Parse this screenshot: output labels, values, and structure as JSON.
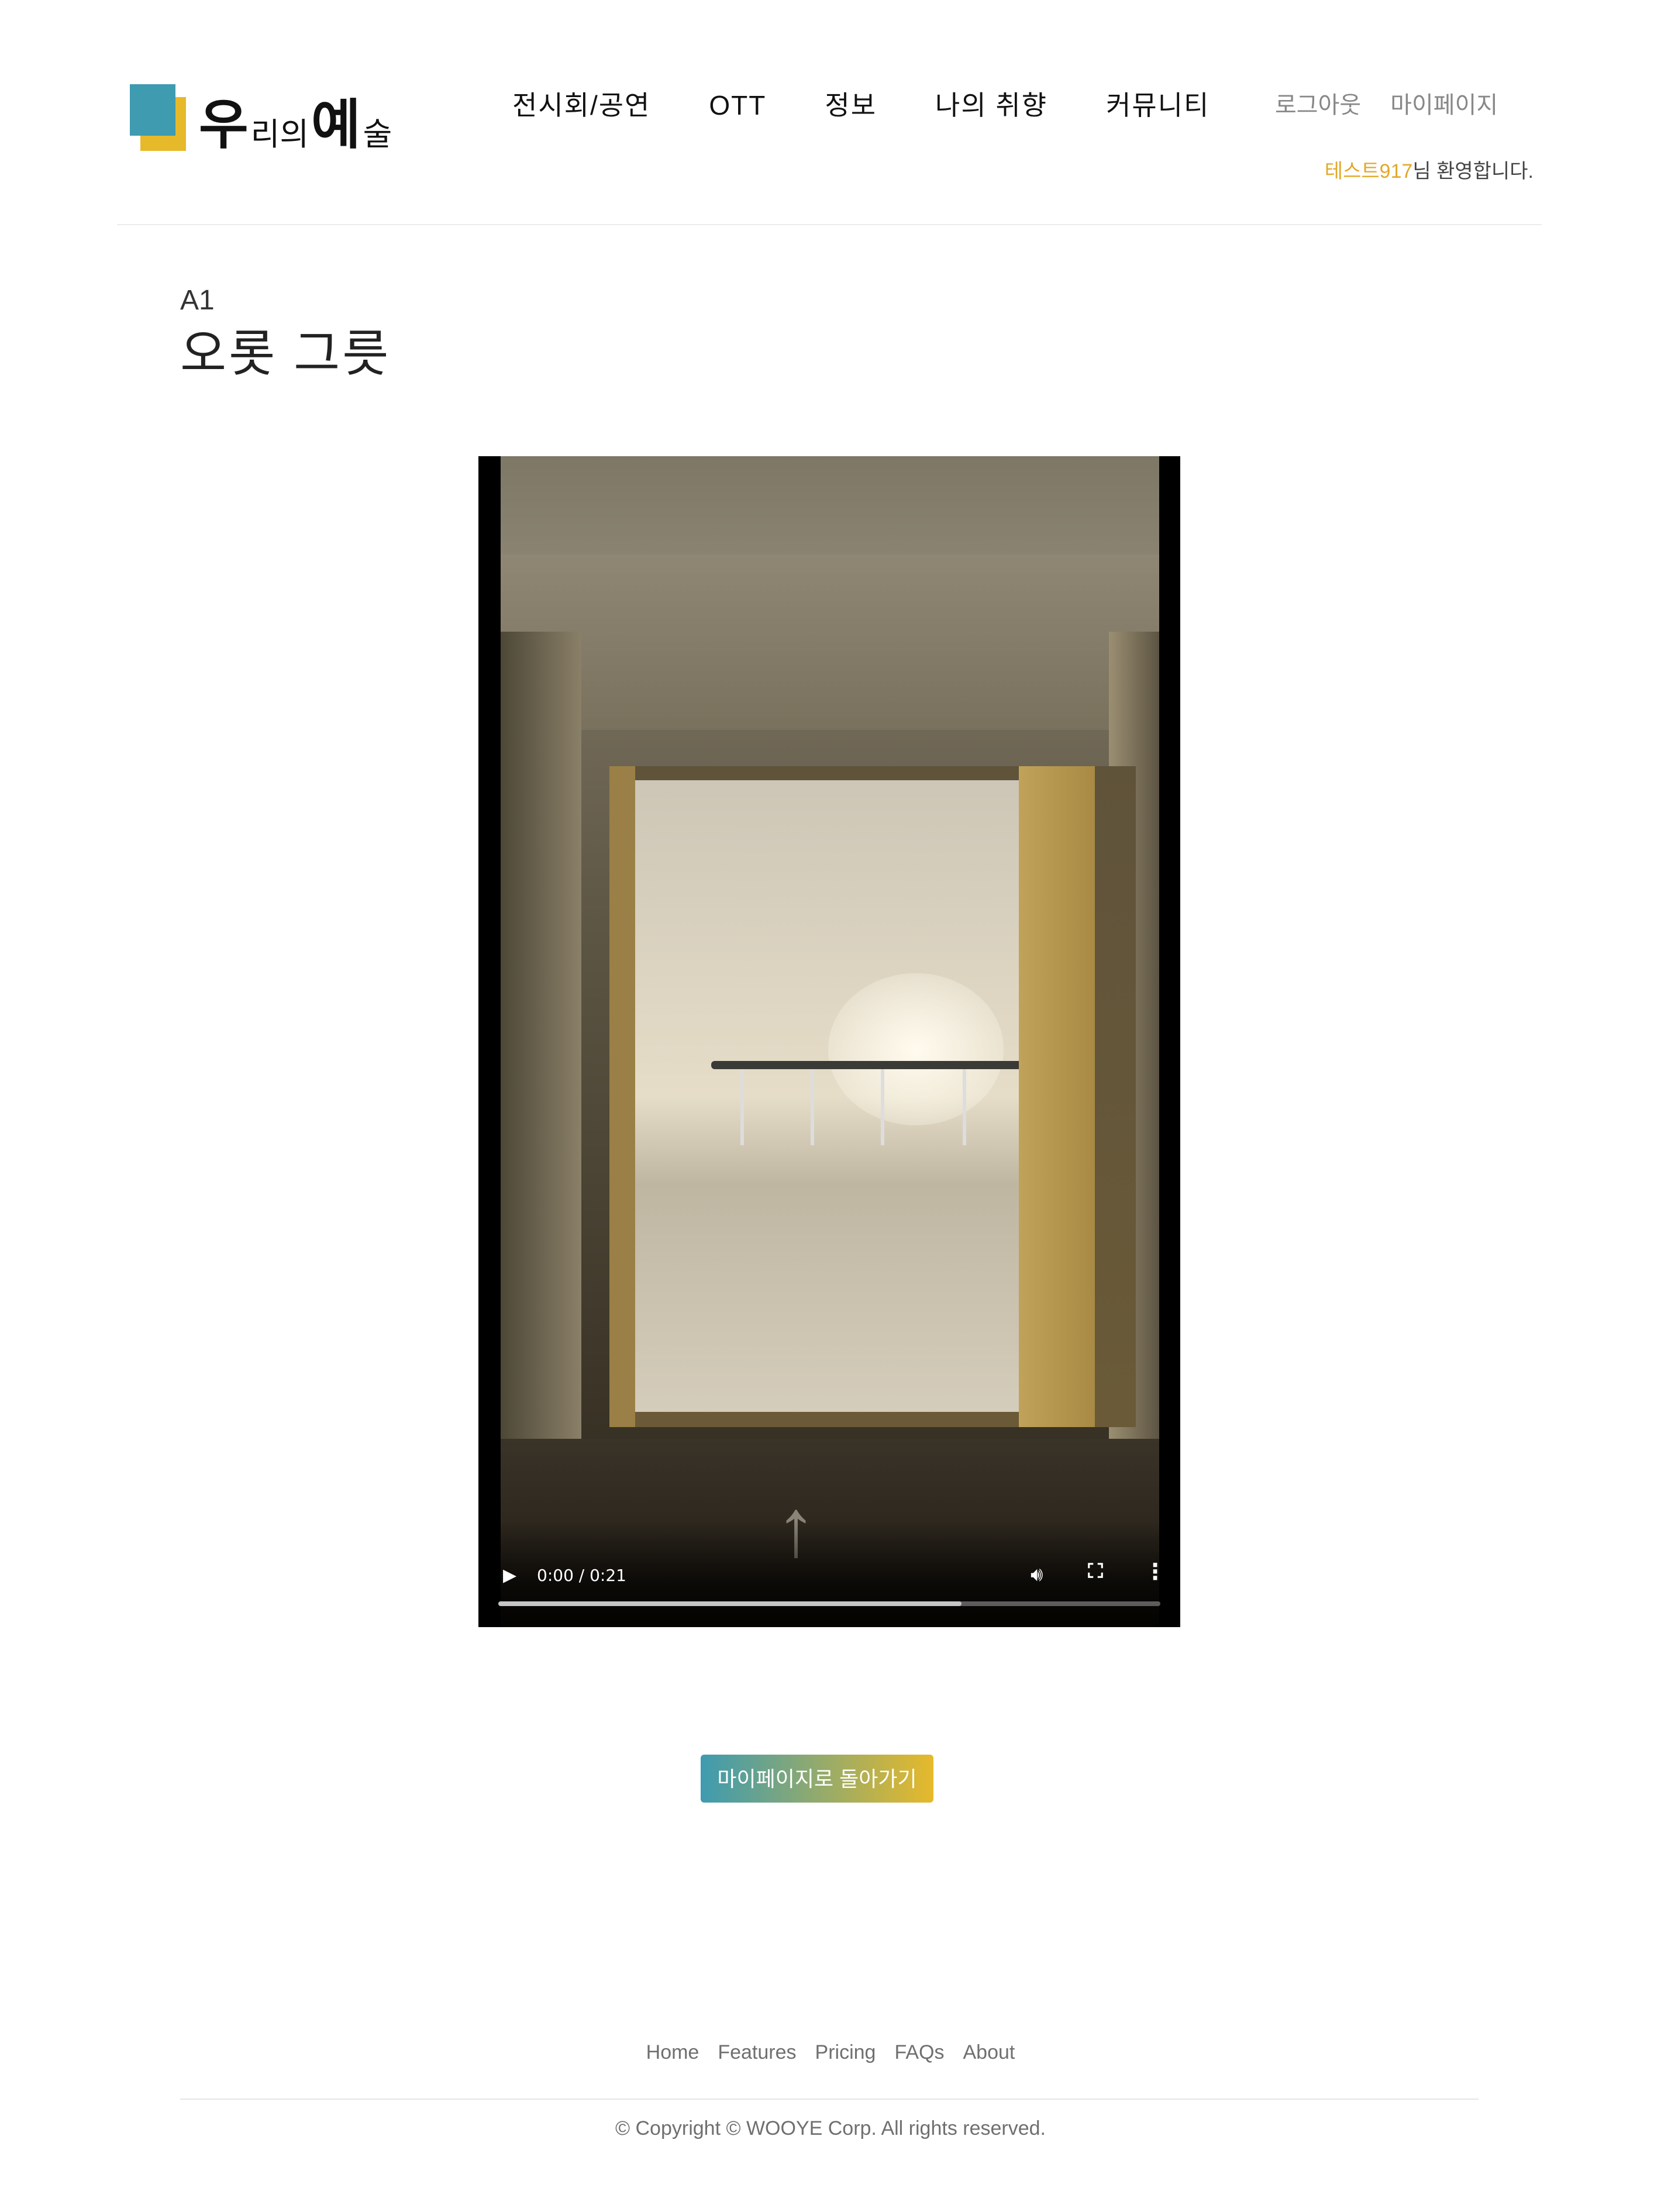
{
  "header": {
    "logo": {
      "text_big_1": "우",
      "text_small_1": "리의",
      "text_big_2": "예",
      "text_small_2": "술"
    },
    "nav": [
      "전시회/공연",
      "OTT",
      "정보",
      "나의 취향",
      "커뮤니티"
    ],
    "user_links": [
      "로그아웃",
      "마이페이지"
    ],
    "welcome": {
      "username": "테스트917",
      "suffix": "님 환영합니다."
    }
  },
  "content": {
    "subtitle": "A1",
    "title": "오롯 그릇",
    "video": {
      "time": "0:00 / 0:21",
      "buffered_fraction": 0.7
    },
    "back_button": "마이페이지로 돌아가기"
  },
  "footer": {
    "links": [
      "Home",
      "Features",
      "Pricing",
      "FAQs",
      "About"
    ],
    "copyright": "© Copyright © WOOYE Corp. All rights reserved."
  },
  "colors": {
    "brand_blue": "#3E9BB0",
    "brand_yellow": "#E6B92B"
  }
}
